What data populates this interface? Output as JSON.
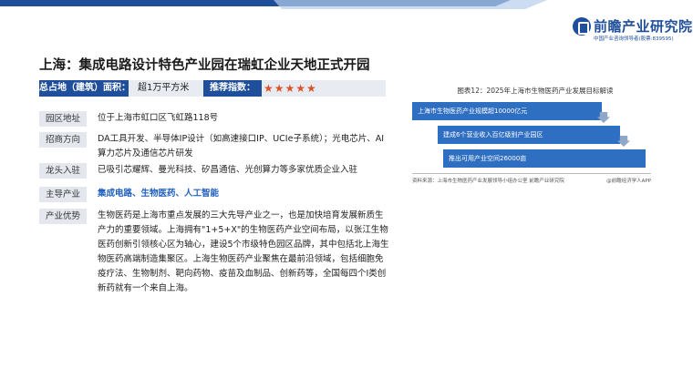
{
  "header": {
    "logo_text": "前瞻产业研究院",
    "logo_subtitle": "中国产业咨询领导者(股票:839595)",
    "brand_color": "#1f4e9a"
  },
  "title": "上海：集成电路设计特色产业园在瑞虹企业天地正式开园",
  "summary": {
    "area_label": "总占地（建筑）面积：",
    "area_value": "超1万平方米",
    "recommend_label": "推荐指数：",
    "stars_text": "★★★★★",
    "rating": 5
  },
  "rows": [
    {
      "label": "园区地址",
      "text": "位于上海市虹口区飞虹路118号"
    },
    {
      "label": "招商方向",
      "text": "DA工具开发、半导体IP设计（如高速接口IP、UCIe子系统）；光电芯片、AI算力芯片及通信芯片研发"
    },
    {
      "label": "龙头入驻",
      "text": "已吸引芯耀辉、曼光科技、矽昌通信、光创算力等多家优质企业入驻"
    },
    {
      "label": "主导产业",
      "text": "集成电路、生物医药、人工智能"
    },
    {
      "label": "产业优势",
      "text": "生物医药是上海市重点发展的三大先导产业之一，也是加快培育发展新质生产力的重要领域。上海拥有\"1+5+X\"的生物医药产业空间布局，以张江生物医药创新引领核心区为轴心，建设5个市级特色园区品牌，其中包括北上海生物医药高端制造集聚区。上海生物医药产业聚焦在最前沿领域，包括细胞免疫疗法、生物制剂、靶向药物、疫苗及血制品、创新药等，全国每四个I类创新药就有一个来自上海。"
    }
  ],
  "figure": {
    "title": "图表12：2025年上海市生物医药产业发展目标解读",
    "boxes": [
      "上海市生物医药产业规模超10000亿元",
      "建成6个营业收入百亿级别产业园区",
      "推出可用产业空间26000亩"
    ],
    "source": "资料来源：上海市生物医药产业发展领导小组办公室 前瞻产业研究院",
    "credit": "@前瞻经济学人APP"
  }
}
